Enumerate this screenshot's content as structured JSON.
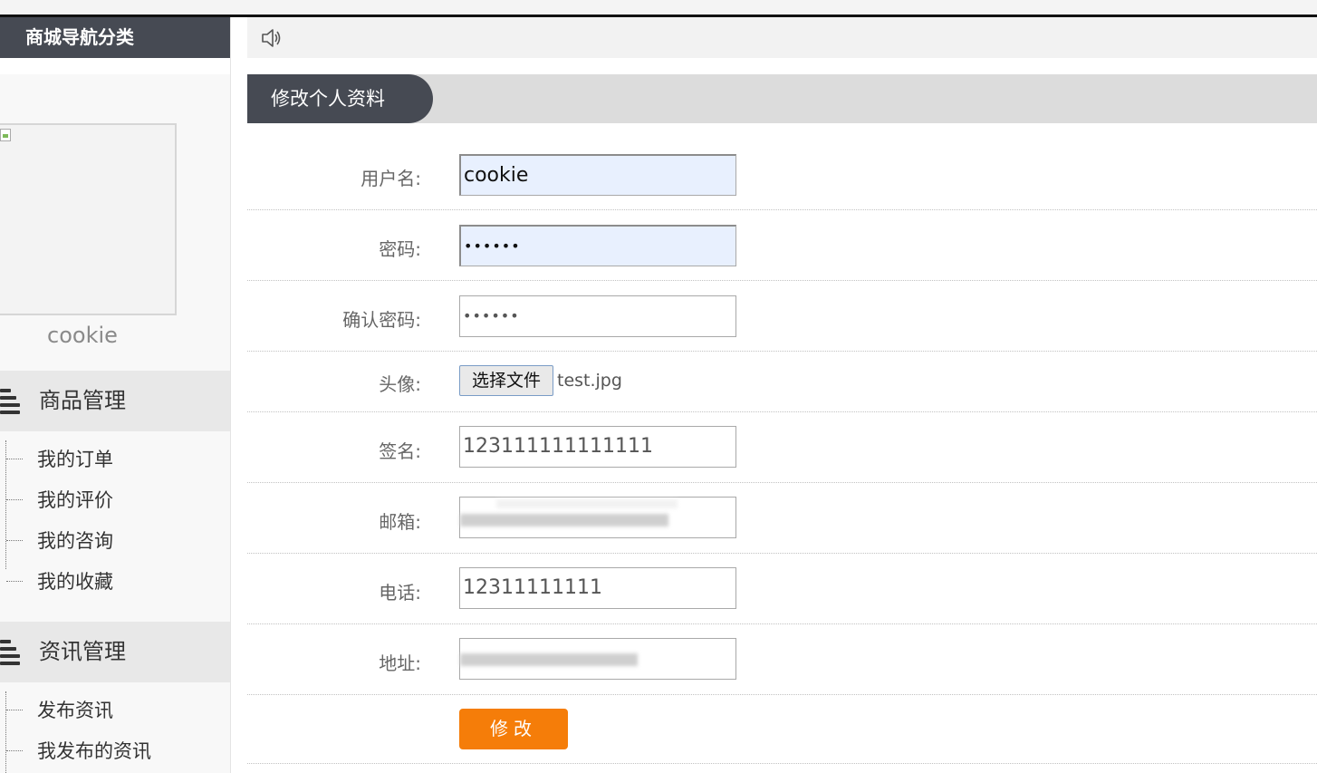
{
  "sidebar": {
    "header": "商城导航分类",
    "user_name": "cookie",
    "sections": [
      {
        "title": "商品管理",
        "items": [
          "我的订单",
          "我的评价",
          "我的咨询",
          "我的收藏"
        ]
      },
      {
        "title": "资讯管理",
        "items": [
          "发布资讯",
          "我发布的资讯"
        ]
      }
    ]
  },
  "main": {
    "title": "修改个人资料",
    "form": {
      "username_label": "用户名:",
      "username_value": "cookie",
      "password_label": "密码:",
      "password_value": "••••••",
      "confirm_label": "确认密码:",
      "confirm_value": "••••••",
      "avatar_label": "头像:",
      "avatar_button": "选择文件",
      "avatar_file": "test.jpg",
      "signature_label": "签名:",
      "signature_value": "123111111111111",
      "email_label": "邮箱:",
      "phone_label": "电话:",
      "phone_value": "12311111111",
      "address_label": "地址:",
      "submit_label": "修改"
    }
  },
  "colors": {
    "accent": "#f57d09",
    "header_dark": "#464a53"
  }
}
